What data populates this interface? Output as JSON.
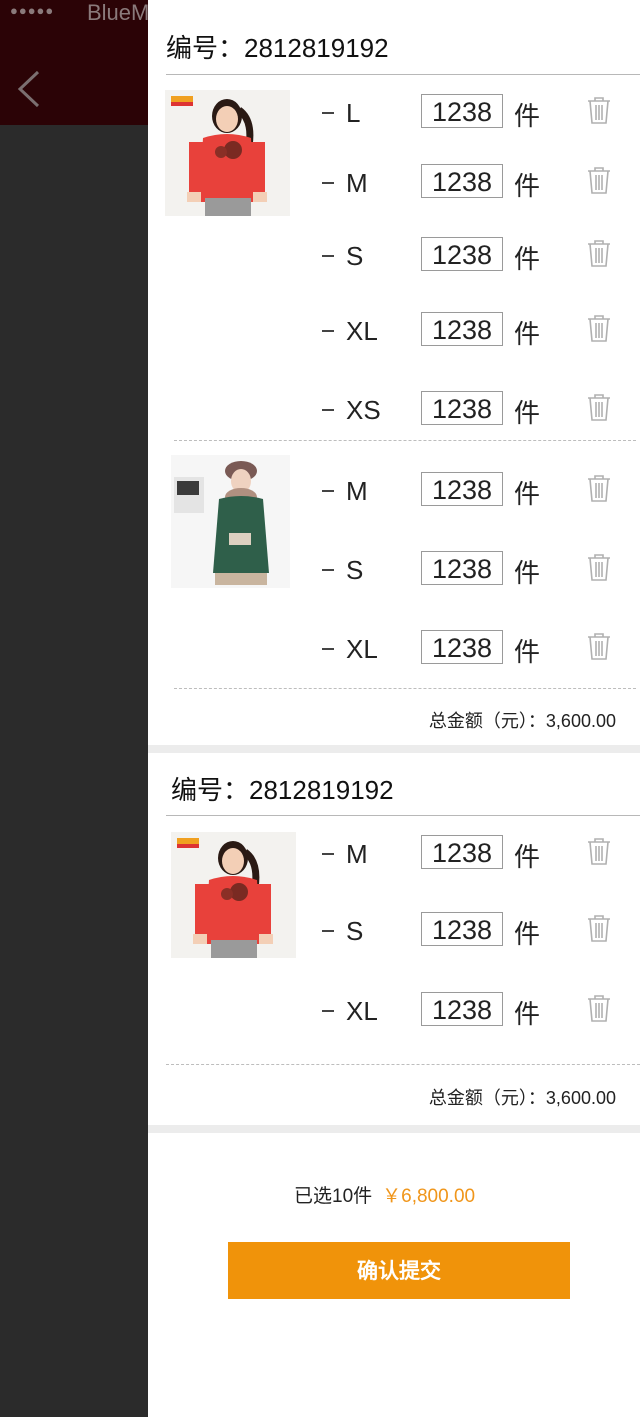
{
  "status_bar": {
    "dots": "●●●●●",
    "carrier": "BlueM"
  },
  "orders": [
    {
      "id_label": "编号：2812819192",
      "products": [
        {
          "image": "product-photo-girl-red-top",
          "items": [
            {
              "size": "L",
              "qty": "1238",
              "unit": "件"
            },
            {
              "size": "M",
              "qty": "1238",
              "unit": "件"
            },
            {
              "size": "S",
              "qty": "1238",
              "unit": "件"
            },
            {
              "size": "XL",
              "qty": "1238",
              "unit": "件"
            },
            {
              "size": "XS",
              "qty": "1238",
              "unit": "件"
            }
          ]
        },
        {
          "image": "product-photo-girl-green-coat",
          "items": [
            {
              "size": "M",
              "qty": "1238",
              "unit": "件"
            },
            {
              "size": "S",
              "qty": "1238",
              "unit": "件"
            },
            {
              "size": "XL",
              "qty": "1238",
              "unit": "件"
            }
          ]
        }
      ],
      "total": "总金额（元）：3,600.00"
    },
    {
      "id_label": "编号：2812819192",
      "products": [
        {
          "image": "product-photo-girl-red-top",
          "items": [
            {
              "size": "M",
              "qty": "1238",
              "unit": "件"
            },
            {
              "size": "S",
              "qty": "1238",
              "unit": "件"
            },
            {
              "size": "XL",
              "qty": "1238",
              "unit": "件"
            }
          ]
        }
      ],
      "total": "总金额（元）：3,600.00"
    }
  ],
  "summary": {
    "selected": "已选10件",
    "price": "￥6,800.00"
  },
  "submit_label": "确认提交",
  "colors": {
    "accent": "#f0930a",
    "price": "#f0961b",
    "header_bg": "#2b0306",
    "overlay_bg": "#2b2b2b"
  },
  "icons": {
    "back": "chevron-left-icon",
    "delete": "trash-icon"
  }
}
